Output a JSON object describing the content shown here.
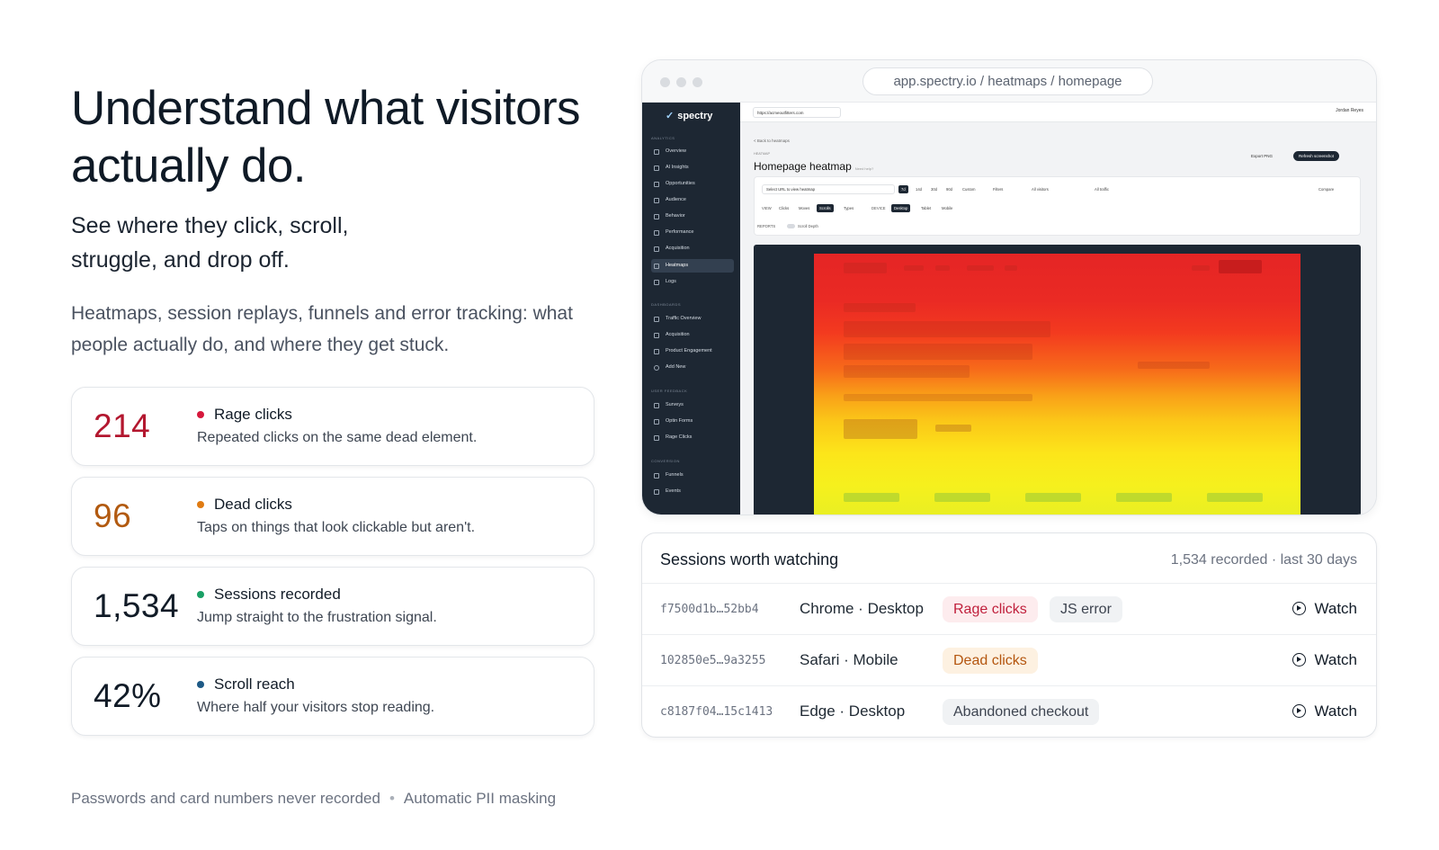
{
  "hero": {
    "title": "Understand what visitors actually do.",
    "subtitle": "See where they click, scroll, struggle, and drop off.",
    "description": "Heatmaps, session replays, funnels and error tracking: what people actually do, and where they get stuck."
  },
  "metrics": [
    {
      "value": "214",
      "label": "Rage clicks",
      "desc": "Repeated clicks on the same dead element.",
      "color": "#b3172f",
      "dot": "#d6183c"
    },
    {
      "value": "96",
      "label": "Dead clicks",
      "desc": "Taps on things that look clickable but aren't.",
      "color": "#b25a10",
      "dot": "#e07b12"
    },
    {
      "value": "1,534",
      "label": "Sessions recorded",
      "desc": "Jump straight to the frustration signal.",
      "color": "#111b27",
      "dot": "#1aa066"
    },
    {
      "value": "42%",
      "label": "Scroll reach",
      "desc": "Where half your visitors stop reading.",
      "color": "#111b27",
      "dot": "#1e5a86"
    }
  ],
  "footer": {
    "note1": "Passwords and card numbers never recorded",
    "sep": "•",
    "note2": "Automatic PII masking"
  },
  "browser": {
    "url": "app.spectry.io / heatmaps / homepage",
    "app": {
      "logo": "spectry",
      "sections": {
        "analytics": "ANALYTICS",
        "dashboards": "DASHBOARDS",
        "user_feedback": "USER FEEDBACK",
        "conversion": "CONVERSION"
      },
      "nav": {
        "overview": "Overview",
        "ai_insights": "AI Insights",
        "opportunities": "Opportunities",
        "audience": "Audience",
        "behavior": "Behavior",
        "performance": "Performance",
        "acquisition": "Acquisition",
        "heatmaps": "Heatmaps",
        "logs": "Logs",
        "traffic_overview": "Traffic Overview",
        "acquisition2": "Acquisition",
        "product_engagement": "Product Engagement",
        "add_new": "Add New",
        "surveys": "Surveys",
        "optin_forms": "Optin Forms",
        "rage_clicks": "Rage Clicks",
        "funnels": "Funnels",
        "events": "Events"
      },
      "site": "https://acmeoutfitters.com",
      "user": "Jordan Reyes",
      "breadcrumb": "< Back to heatmaps",
      "eyebrow": "HEATMAP",
      "page_title": "Homepage heatmap",
      "help": "Need help?",
      "export": "Export PNG",
      "refresh": "Refresh screenshot",
      "filters": {
        "url_placeholder": "Select URL to view heatmap",
        "ranges": [
          "7d",
          "14d",
          "30d",
          "90d",
          "Custom"
        ],
        "filters_label": "Filters",
        "visitors": "All visitors",
        "traffic": "All traffic",
        "compare": "Compare",
        "view_label": "VIEW",
        "views": [
          "Clicks",
          "Moves",
          "Scrolls"
        ],
        "types": "Types",
        "device_label": "DEVICE",
        "devices": [
          "Desktop",
          "Tablet",
          "Mobile"
        ],
        "reports_label": "REPORTS",
        "scroll_depth": "Scroll Depth"
      }
    }
  },
  "sessions": {
    "title": "Sessions worth watching",
    "meta": "1,534 recorded · last 30 days",
    "watch_label": "Watch",
    "rows": [
      {
        "id": "f7500d1b…52bb4",
        "device": "Chrome · Desktop",
        "tags": [
          {
            "text": "Rage clicks",
            "kind": "rage"
          },
          {
            "text": "JS error",
            "kind": "js"
          }
        ]
      },
      {
        "id": "102850e5…9a3255",
        "device": "Safari · Mobile",
        "tags": [
          {
            "text": "Dead clicks",
            "kind": "dead"
          }
        ]
      },
      {
        "id": "c8187f04…15c1413",
        "device": "Edge · Desktop",
        "tags": [
          {
            "text": "Abandoned checkout",
            "kind": "aband"
          }
        ]
      }
    ]
  }
}
